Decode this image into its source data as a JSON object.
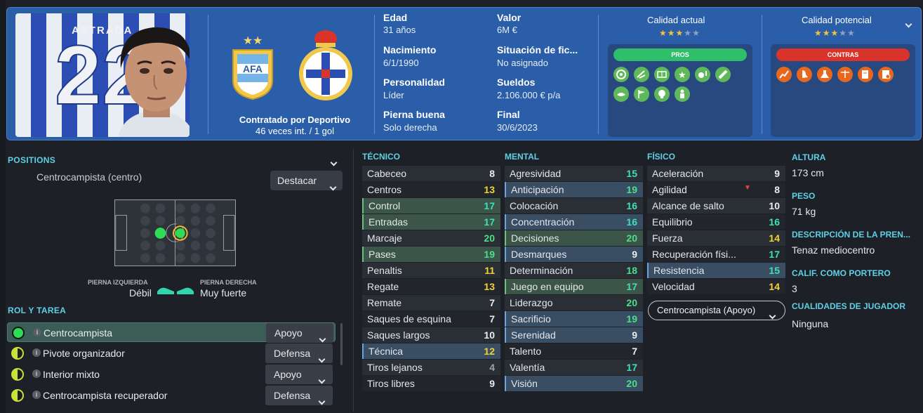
{
  "player": {
    "shirt_name": "ASTRADA",
    "shirt_number": "22"
  },
  "header": {
    "contract_line1": "Contratado por Deportivo",
    "contract_line2": "46 veces int. / 1 gol",
    "info": [
      {
        "label": "Edad",
        "value": "31 años"
      },
      {
        "label": "Nacimiento",
        "value": "6/1/1990"
      },
      {
        "label": "Personalidad",
        "value": "Líder"
      },
      {
        "label": "Pierna buena",
        "value": "Solo derecha"
      },
      {
        "label": "Valor",
        "value": "6M €"
      },
      {
        "label": "Situación de fic...",
        "value": "No asignado"
      },
      {
        "label": "Sueldos",
        "value": "2.106.000 € p/a"
      },
      {
        "label": "Final",
        "value": "30/6/2023"
      }
    ],
    "current_ability_label": "Calidad actual",
    "potential_ability_label": "Calidad potencial",
    "current_stars": 3,
    "potential_stars": 3,
    "pros_label": "PROS",
    "cons_label": "CONTRAS",
    "pros_icons": [
      "target-icon",
      "cross-boot-icon",
      "pitch-icon",
      "star-icon",
      "ball-alert-icon",
      "bandage-icon",
      "handshake-icon",
      "flag-icon",
      "brain-icon",
      "player-icon"
    ],
    "cons_icons": [
      "trend-icon",
      "foot-icon",
      "flask-icon",
      "scales-icon",
      "notes-icon",
      "document-icon"
    ],
    "colors": {
      "pros": "#2fbf6a",
      "cons": "#d9342b",
      "pros_icon": "#5fb85a",
      "cons_icon": "#e8671f"
    }
  },
  "positions": {
    "title": "POSITIONS",
    "position_name": "Centrocampista (centro)",
    "highlight_button": "Destacar",
    "left_foot_label": "PIERNA IZQUIERDA",
    "left_foot_value": "Débil",
    "right_foot_label": "PIERNA DERECHA",
    "right_foot_value": "Muy fuerte"
  },
  "roles": {
    "title": "ROL Y TAREA",
    "items": [
      {
        "name": "Centrocampista",
        "duty": "Apoyo",
        "selected": true
      },
      {
        "name": "Pivote organizador",
        "duty": "Defensa",
        "selected": false
      },
      {
        "name": "Interior mixto",
        "duty": "Apoyo",
        "selected": false
      },
      {
        "name": "Centrocampista recuperador",
        "duty": "Defensa",
        "selected": false
      }
    ]
  },
  "attributes": {
    "technical_title": "TÉCNICO",
    "mental_title": "MENTAL",
    "physical_title": "FÍSICO",
    "technical": [
      {
        "name": "Cabeceo",
        "value": "8",
        "hl": ""
      },
      {
        "name": "Centros",
        "value": "13",
        "hl": ""
      },
      {
        "name": "Control",
        "value": "17",
        "hl": "green"
      },
      {
        "name": "Entradas",
        "value": "17",
        "hl": "green"
      },
      {
        "name": "Marcaje",
        "value": "20",
        "hl": ""
      },
      {
        "name": "Pases",
        "value": "19",
        "hl": "green"
      },
      {
        "name": "Penaltis",
        "value": "11",
        "hl": ""
      },
      {
        "name": "Regate",
        "value": "13",
        "hl": ""
      },
      {
        "name": "Remate",
        "value": "7",
        "hl": ""
      },
      {
        "name": "Saques de esquina",
        "value": "7",
        "hl": ""
      },
      {
        "name": "Saques largos",
        "value": "10",
        "hl": ""
      },
      {
        "name": "Técnica",
        "value": "12",
        "hl": "blue"
      },
      {
        "name": "Tiros lejanos",
        "value": "4",
        "hl": ""
      },
      {
        "name": "Tiros libres",
        "value": "9",
        "hl": ""
      }
    ],
    "mental": [
      {
        "name": "Agresividad",
        "value": "15",
        "hl": ""
      },
      {
        "name": "Anticipación",
        "value": "19",
        "hl": "blue"
      },
      {
        "name": "Colocación",
        "value": "16",
        "hl": ""
      },
      {
        "name": "Concentración",
        "value": "16",
        "hl": "blue"
      },
      {
        "name": "Decisiones",
        "value": "20",
        "hl": "green"
      },
      {
        "name": "Desmarques",
        "value": "9",
        "hl": "blue"
      },
      {
        "name": "Determinación",
        "value": "18",
        "hl": ""
      },
      {
        "name": "Juego en equipo",
        "value": "17",
        "hl": "green"
      },
      {
        "name": "Liderazgo",
        "value": "20",
        "hl": ""
      },
      {
        "name": "Sacrificio",
        "value": "19",
        "hl": "blue"
      },
      {
        "name": "Serenidad",
        "value": "9",
        "hl": "blue"
      },
      {
        "name": "Talento",
        "value": "7",
        "hl": ""
      },
      {
        "name": "Valentía",
        "value": "17",
        "hl": ""
      },
      {
        "name": "Visión",
        "value": "20",
        "hl": "blue"
      }
    ],
    "physical": [
      {
        "name": "Aceleración",
        "value": "9",
        "hl": ""
      },
      {
        "name": "Agilidad",
        "value": "8",
        "hl": "",
        "down": true
      },
      {
        "name": "Alcance de salto",
        "value": "10",
        "hl": ""
      },
      {
        "name": "Equilibrio",
        "value": "16",
        "hl": ""
      },
      {
        "name": "Fuerza",
        "value": "14",
        "hl": ""
      },
      {
        "name": "Recuperación físi...",
        "value": "17",
        "hl": ""
      },
      {
        "name": "Resistencia",
        "value": "15",
        "hl": "blue"
      },
      {
        "name": "Velocidad",
        "value": "14",
        "hl": ""
      }
    ],
    "role_select": "Centrocampista (Apoyo)"
  },
  "details": [
    {
      "label": "ALTURA",
      "value": "173 cm"
    },
    {
      "label": "PESO",
      "value": "71 kg"
    },
    {
      "label": "DESCRIPCIÓN DE LA PREN...",
      "value": "Tenaz mediocentro"
    },
    {
      "label": "CALIF. COMO PORTERO",
      "value": "3"
    },
    {
      "label": "CUALIDADES DE JUGADOR",
      "value": "Ninguna"
    }
  ]
}
